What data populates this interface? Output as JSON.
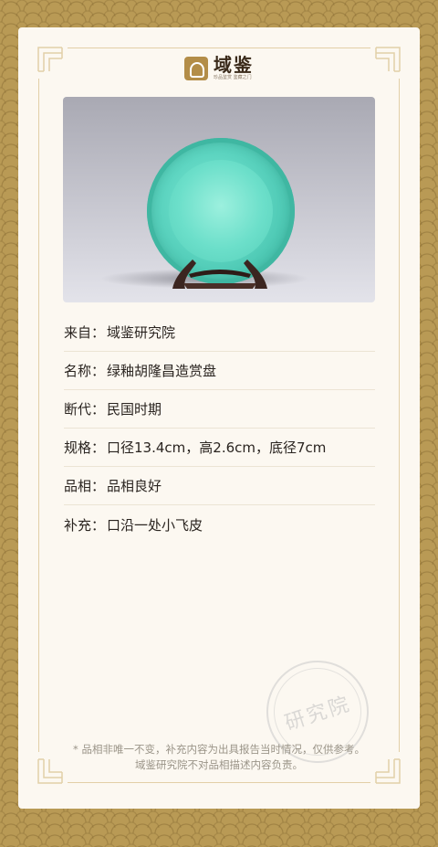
{
  "brand": {
    "name": "域鉴",
    "tagline": "珍品鉴赏 鉴藏之门",
    "accent_color": "#b38d48"
  },
  "photo": {
    "subject": "green-glazed-plate-on-wooden-stand"
  },
  "details": [
    {
      "label": "来自：",
      "value": "域鉴研究院"
    },
    {
      "label": "名称：",
      "value": "绿釉胡隆昌造赏盘"
    },
    {
      "label": "断代：",
      "value": "民国时期"
    },
    {
      "label": "规格：",
      "value": "口径13.4cm，高2.6cm，底径7cm"
    },
    {
      "label": "品相：",
      "value": "品相良好"
    },
    {
      "label": "补充：",
      "value": "口沿一处小飞皮"
    }
  ],
  "footnote": "* 品相非唯一不变，补充内容为出具报告当时情况，仅供参考。域鉴研究院不对品相描述内容负责。",
  "seal": {
    "text": "研究院"
  },
  "colors": {
    "background": "#b99a55",
    "card": "#fcf8f1",
    "frame": "#e2cfa7"
  }
}
